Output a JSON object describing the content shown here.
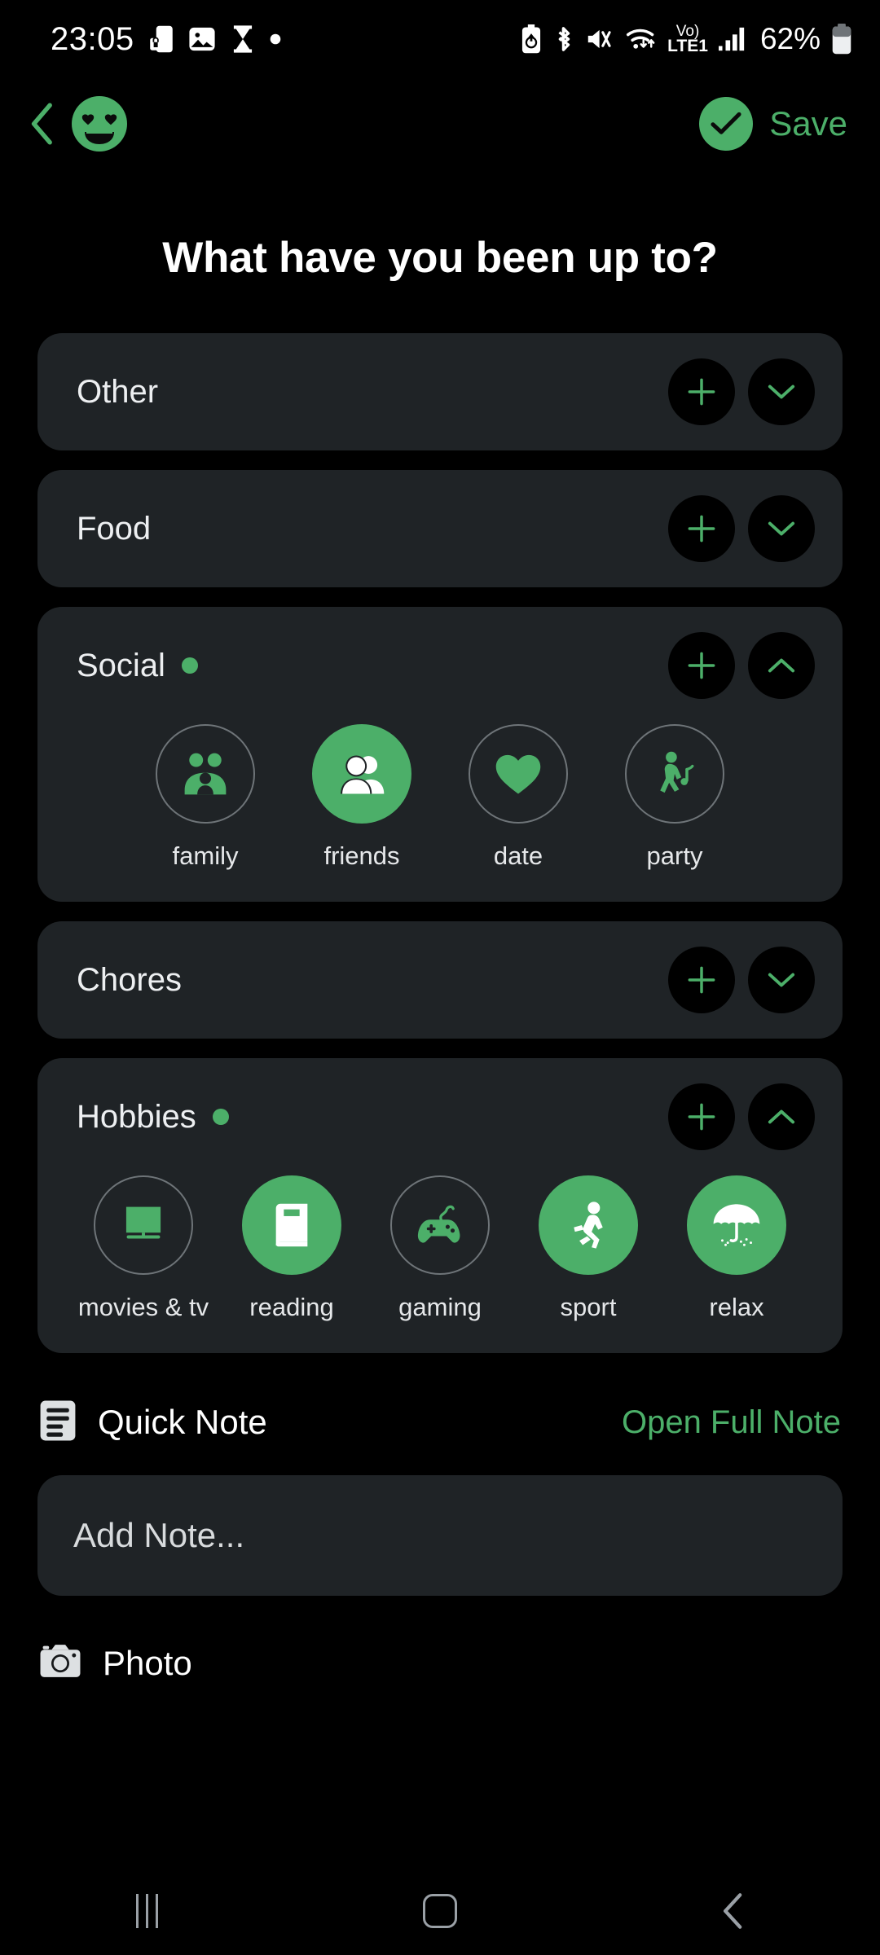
{
  "status_bar": {
    "time": "23:05",
    "left_icons": [
      "phone-lock-icon",
      "image-icon",
      "hourglass-icon",
      "dot-icon"
    ],
    "right_icons": [
      "battery-saver-icon",
      "bluetooth-icon",
      "mute-icon",
      "wifi-icon",
      "volte-icon",
      "signal-icon"
    ],
    "volte_top": "Vo)",
    "volte_bottom": "LTE1",
    "battery_percent": "62%"
  },
  "appbar": {
    "back_icon": "chevron-left-icon",
    "avatar_icon": "heart-eyes-smiley-avatar",
    "save_icon": "check-circle-icon",
    "save_label": "Save"
  },
  "page_title": "What have you been up to?",
  "colors": {
    "accent": "#4CAF69",
    "card": "#1F2326",
    "background": "#000000",
    "outline": "#6E7478"
  },
  "categories": [
    {
      "name": "Other",
      "has_selection": false,
      "expanded": false,
      "add_label": "+",
      "toggle_icon": "chevron-down-icon",
      "chips": []
    },
    {
      "name": "Food",
      "has_selection": false,
      "expanded": false,
      "add_label": "+",
      "toggle_icon": "chevron-down-icon",
      "chips": []
    },
    {
      "name": "Social",
      "has_selection": true,
      "expanded": true,
      "add_label": "+",
      "toggle_icon": "chevron-up-icon",
      "chips": [
        {
          "label": "family",
          "icon": "family-icon",
          "selected": false
        },
        {
          "label": "friends",
          "icon": "friends-icon",
          "selected": true
        },
        {
          "label": "date",
          "icon": "heart-icon",
          "selected": false
        },
        {
          "label": "party",
          "icon": "party-icon",
          "selected": false
        }
      ]
    },
    {
      "name": "Chores",
      "has_selection": false,
      "expanded": false,
      "add_label": "+",
      "toggle_icon": "chevron-down-icon",
      "chips": []
    },
    {
      "name": "Hobbies",
      "has_selection": true,
      "expanded": true,
      "add_label": "+",
      "toggle_icon": "chevron-up-icon",
      "chips": [
        {
          "label": "movies & tv",
          "icon": "tv-icon",
          "selected": false
        },
        {
          "label": "reading",
          "icon": "book-icon",
          "selected": true
        },
        {
          "label": "gaming",
          "icon": "gamepad-icon",
          "selected": false
        },
        {
          "label": "sport",
          "icon": "running-icon",
          "selected": true
        },
        {
          "label": "relax",
          "icon": "umbrella-icon",
          "selected": true
        }
      ]
    }
  ],
  "quick_note": {
    "icon": "note-icon",
    "title": "Quick Note",
    "link_label": "Open Full Note",
    "placeholder": "Add Note..."
  },
  "photo": {
    "icon": "camera-icon",
    "label": "Photo"
  },
  "navbar": {
    "recents_icon": "recents-icon",
    "home_icon": "home-icon",
    "back_icon": "nav-back-icon"
  }
}
